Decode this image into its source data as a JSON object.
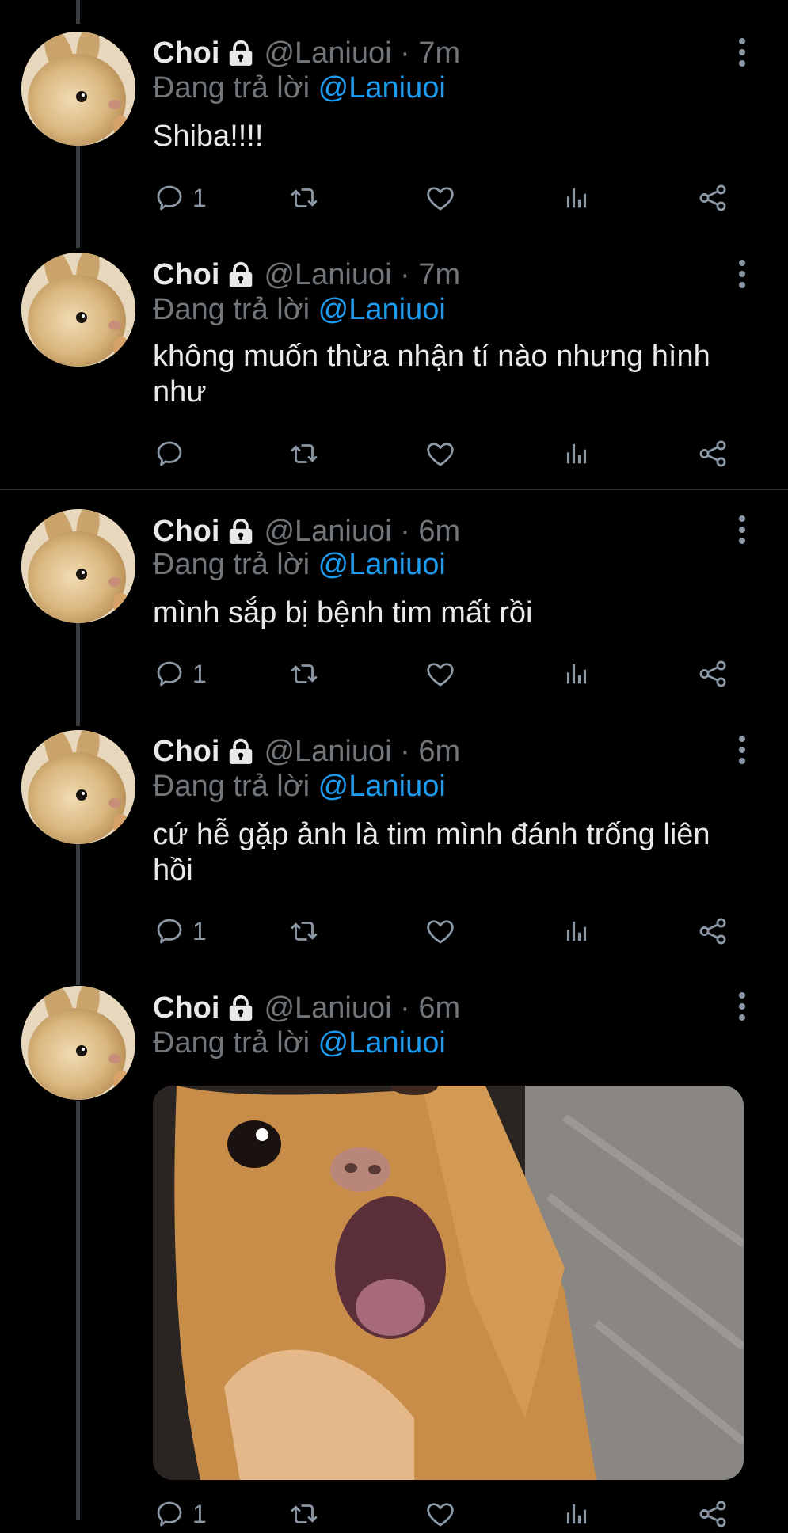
{
  "tweets": [
    {
      "name": "Choi",
      "handle": "@Laniuoi · 7m",
      "replying_prefix": "Đang trả lời",
      "replying_to": "@Laniuoi",
      "text": "Shiba!!!!",
      "reply_count": "1"
    },
    {
      "name": "Choi",
      "handle": "@Laniuoi · 7m",
      "replying_prefix": "Đang trả lời",
      "replying_to": "@Laniuoi",
      "text": "không muốn thừa nhận tí nào nhưng hình như",
      "reply_count": ""
    },
    {
      "name": "Choi",
      "handle": "@Laniuoi · 6m",
      "replying_prefix": "Đang trả lời",
      "replying_to": "@Laniuoi",
      "text": "mình sắp bị bệnh tim mất rồi",
      "reply_count": "1"
    },
    {
      "name": "Choi",
      "handle": "@Laniuoi · 6m",
      "replying_prefix": "Đang trả lời",
      "replying_to": "@Laniuoi",
      "text": "cứ hễ gặp ảnh là tim mình đánh trống liên hồi",
      "reply_count": "1"
    },
    {
      "name": "Choi",
      "handle": "@Laniuoi · 6m",
      "replying_prefix": "Đang trả lời",
      "replying_to": "@Laniuoi",
      "text": "",
      "reply_count": "1"
    }
  ],
  "icons": {
    "reply": "reply-icon",
    "retweet": "retweet-icon",
    "like": "heart-icon",
    "analytics": "analytics-icon",
    "share": "share-icon",
    "more": "more-vertical-icon",
    "lock": "lock-icon"
  },
  "colors": {
    "background": "#000000",
    "mention": "#1d9bf0",
    "secondary_text": "#71767b",
    "icon": "#8b98a5"
  }
}
